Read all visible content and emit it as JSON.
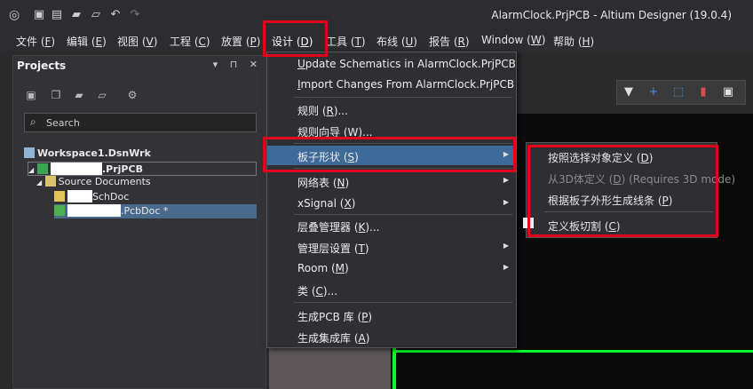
{
  "app": {
    "title": "AlarmClock.PrjPCB - Altium Designer (19.0.4)"
  },
  "menubar": {
    "items": [
      {
        "label": "文件 (",
        "key": "F",
        "tail": ")"
      },
      {
        "label": "编辑 (",
        "key": "E",
        "tail": ")"
      },
      {
        "label": "视图 (",
        "key": "V",
        "tail": ")"
      },
      {
        "label": "工程 (",
        "key": "C",
        "tail": ")"
      },
      {
        "label": "放置 (",
        "key": "P",
        "tail": ")"
      },
      {
        "label": "设计 (",
        "key": "D",
        "tail": ")"
      },
      {
        "label": "工具 (",
        "key": "T",
        "tail": ")"
      },
      {
        "label": "布线 (",
        "key": "U",
        "tail": ")"
      },
      {
        "label": "报告 (",
        "key": "R",
        "tail": ")"
      },
      {
        "label": "Window (",
        "key": "W",
        "tail": ")"
      },
      {
        "label": "帮助 (",
        "key": "H",
        "tail": ")"
      }
    ]
  },
  "panel": {
    "title": "Projects",
    "controls": "▾ ⊓ ✕",
    "search_placeholder": "Search",
    "tree": {
      "workspace": "Workspace1.DsnWrk",
      "project_suffix": ".PrjPCB",
      "folder": "Source Documents",
      "schdoc_suffix": "SchDoc",
      "pcbdoc_suffix": ".PcbDoc *"
    }
  },
  "design_menu": {
    "items": [
      {
        "pre": "",
        "key": "U",
        "post": "pdate Schematics in AlarmClock.PrjPCB"
      },
      {
        "pre": "",
        "key": "I",
        "post": "mport Changes From AlarmClock.PrjPCB"
      },
      {
        "pre": "规则 (",
        "key": "R",
        "post": ")..."
      },
      {
        "pre": "规则向导 (",
        "key": "W",
        "post": ")..."
      },
      {
        "pre": "板子形状 (",
        "key": "S",
        "post": ")"
      },
      {
        "pre": "网络表 (",
        "key": "N",
        "post": ")"
      },
      {
        "pre": "xSignal (",
        "key": "X",
        "post": ")"
      },
      {
        "pre": "层叠管理器 (",
        "key": "K",
        "post": ")..."
      },
      {
        "pre": "管理层设置 (",
        "key": "T",
        "post": ")"
      },
      {
        "pre": "Room (",
        "key": "M",
        "post": ")"
      },
      {
        "pre": "类 (",
        "key": "C",
        "post": ")..."
      },
      {
        "pre": "生成PCB 库 (",
        "key": "P",
        "post": ")"
      },
      {
        "pre": "生成集成库 (",
        "key": "A",
        "post": ")"
      }
    ]
  },
  "board_shape_menu": {
    "items": [
      {
        "pre": "按照选择对象定义 (",
        "key": "D",
        "post": ")"
      },
      {
        "pre": "从3D体定义 (",
        "key": "D",
        "post": ") (Requires 3D mode)"
      },
      {
        "pre": "根据板子外形生成线条 (",
        "key": "P",
        "post": ")"
      },
      {
        "pre": "定义板切割 (",
        "key": "C",
        "post": ")"
      }
    ]
  },
  "colors": {
    "highlight_box": "#e0001b",
    "menu_highlight": "#3e6a99",
    "board_outline": "#00ff2a"
  }
}
